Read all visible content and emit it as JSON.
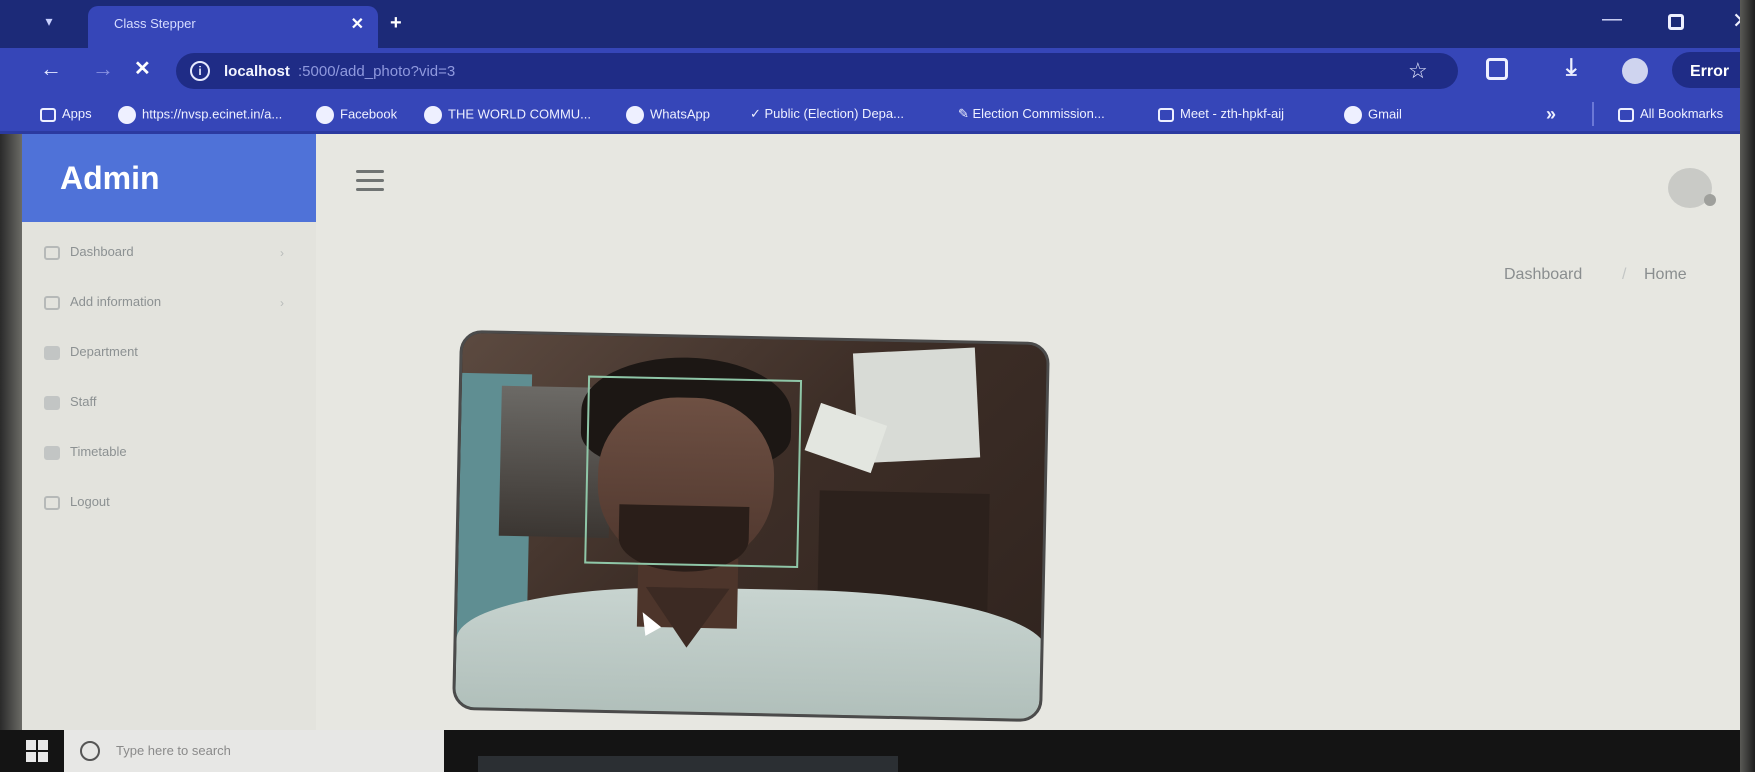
{
  "browser": {
    "tab_title": "Class Stepper",
    "url_host": "localhost",
    "url_path": ":5000/add_photo?vid=3",
    "error_label": "Error",
    "bookmarks": [
      {
        "label": "Apps"
      },
      {
        "label": "https://nvsp.ecinet.in/a..."
      },
      {
        "label": "Facebook"
      },
      {
        "label": "THE WORLD COMMU..."
      },
      {
        "label": "WhatsApp"
      },
      {
        "label": "Public (Election) Depa..."
      },
      {
        "label": "Election Commission..."
      },
      {
        "label": "Meet - zth-hpkf-aij"
      },
      {
        "label": "Gmail"
      }
    ],
    "all_bookmarks_label": "All Bookmarks"
  },
  "app": {
    "brand": "Admin",
    "sidebar": {
      "items": [
        {
          "label": "Dashboard"
        },
        {
          "label": "Add information"
        },
        {
          "label": "Department"
        },
        {
          "label": "Staff"
        },
        {
          "label": "Timetable"
        },
        {
          "label": "Logout"
        }
      ]
    },
    "breadcrumb": {
      "first": "Dashboard",
      "second": "Home"
    }
  },
  "taskbar": {
    "search_placeholder": "Type here to search"
  },
  "colors": {
    "brand_blue": "#4f72d8",
    "browser_frame": "#3646b8",
    "face_box": "#8fc7a8"
  }
}
